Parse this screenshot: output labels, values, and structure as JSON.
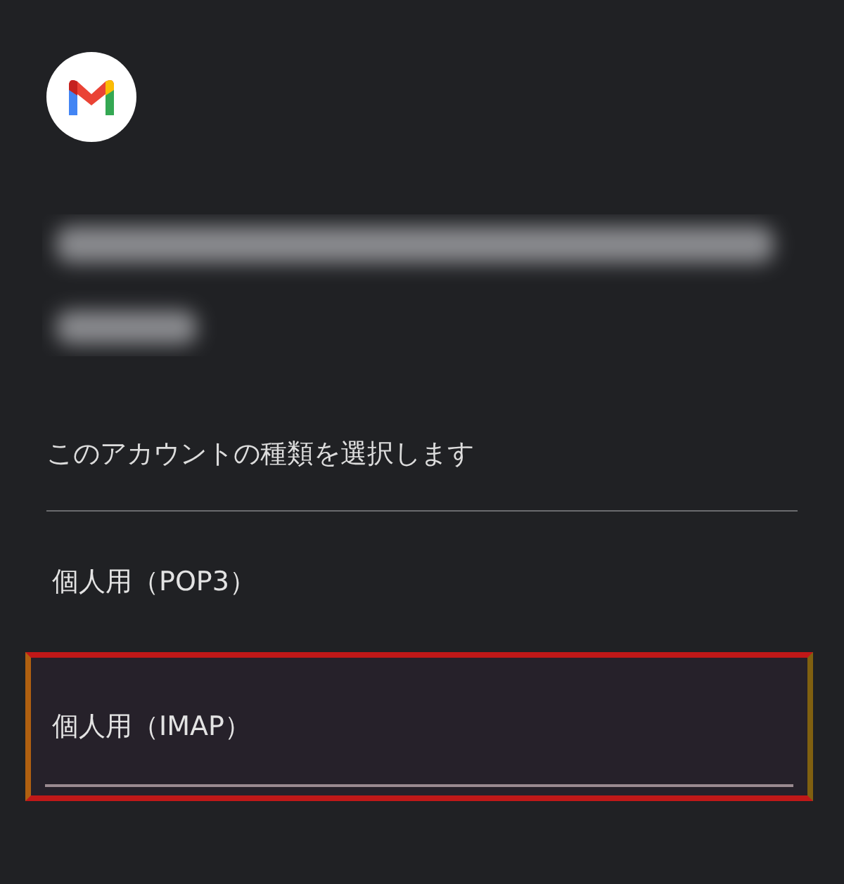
{
  "heading": "このアカウントの種類を選択します",
  "options": [
    {
      "label": "個人用（POP3）",
      "selected": false
    },
    {
      "label": "個人用（IMAP）",
      "selected": true
    }
  ]
}
